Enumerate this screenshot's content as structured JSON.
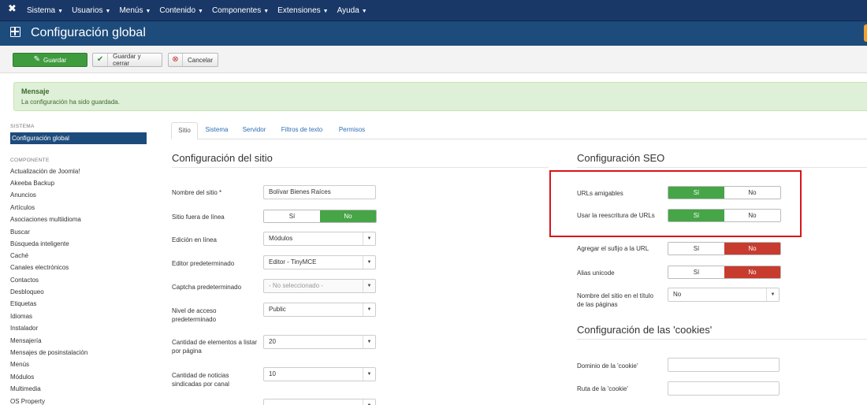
{
  "menubar": {
    "logo_icon": "joomla-x-icon",
    "items": [
      "Sistema",
      "Usuarios",
      "Menús",
      "Contenido",
      "Componentes",
      "Extensiones",
      "Ayuda"
    ]
  },
  "header": {
    "title": "Configuración global",
    "icon": "grid-icon"
  },
  "toolbar": {
    "save": "Guardar",
    "save_close": "Guardar y cerrar",
    "cancel": "Cancelar"
  },
  "alert": {
    "title": "Mensaje",
    "message": "La configuración ha sido guardada."
  },
  "sidebar": {
    "system_heading": "SISTEMA",
    "system_active": "Configuración global",
    "component_heading": "COMPONENTE",
    "components": [
      "Actualización de Joomla!",
      "Akeeba Backup",
      "Anuncios",
      "Artículos",
      "Asociaciones multiidioma",
      "Buscar",
      "Búsqueda inteligente",
      "Caché",
      "Canales electrónicos",
      "Contactos",
      "Desbloqueo",
      "Etiquetas",
      "Idiomas",
      "Instalador",
      "Mensajería",
      "Mensajes de posinstalación",
      "Menús",
      "Módulos",
      "Multimedia",
      "OS Property"
    ]
  },
  "tabs": [
    "Sitio",
    "Sistema",
    "Servidor",
    "Filtros de texto",
    "Permisos"
  ],
  "site": {
    "title": "Configuración del sitio",
    "site_name_label": "Nombre del sitio *",
    "site_name_value": "Bolívar Bienes Raíces",
    "offline_label": "Sitio fuera de línea",
    "offline_yes": "Sí",
    "offline_no": "No",
    "inline_edit_label": "Edición en línea",
    "inline_edit_value": "Módulos",
    "editor_label": "Editor predeterminado",
    "editor_value": "Editor - TinyMCE",
    "captcha_label": "Captcha predeterminado",
    "captcha_value": "- No seleccionado -",
    "access_label": "Nivel de acceso predeterminado",
    "access_value": "Public",
    "list_label": "Cantidad de elementos a listar por página",
    "list_value": "20",
    "feed_label": "Cantidad de noticias sindicadas por canal",
    "feed_value": "10"
  },
  "seo": {
    "title": "Configuración SEO",
    "sef_label": "URLs amigables",
    "sef_yes": "Sí",
    "sef_no": "No",
    "rewrite_label": "Usar la reescritura de URLs",
    "rewrite_yes": "Sí",
    "rewrite_no": "No",
    "suffix_label": "Agregar el sufijo a la URL",
    "suffix_yes": "Sí",
    "suffix_no": "No",
    "unicode_label": "Alias unicode",
    "unicode_yes": "Sí",
    "unicode_no": "No",
    "sitename_title_label": "Nombre del sitio en el título de las páginas",
    "sitename_title_value": "No"
  },
  "cookies": {
    "title": "Configuración de las 'cookies'",
    "domain_label": "Dominio de la 'cookie'",
    "path_label": "Ruta de la 'cookie'"
  },
  "colors": {
    "toggle_green": "#46a546",
    "toggle_red": "#c73c2f",
    "header_blue": "#1d4b7c",
    "highlight_red": "#d9141b"
  }
}
